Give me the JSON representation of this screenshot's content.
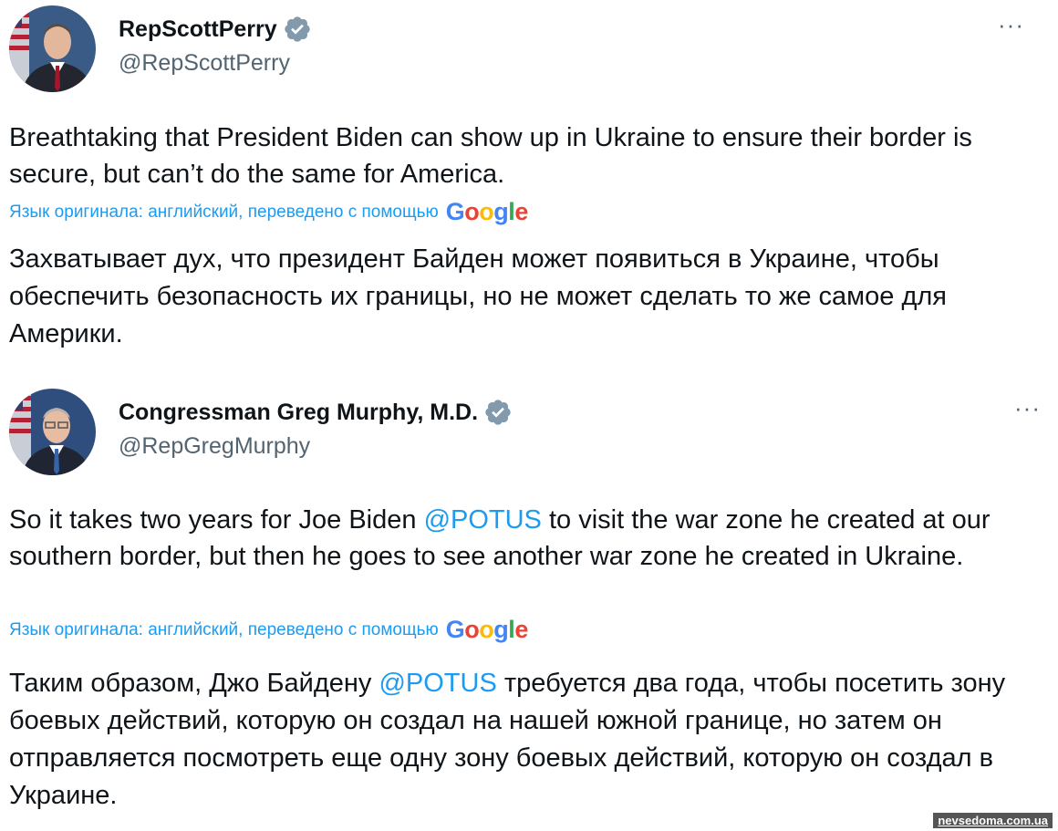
{
  "tweets": [
    {
      "display_name": "RepScottPerry",
      "handle": "@RepScottPerry",
      "more_label": "···",
      "text_en": "Breathtaking that President Biden can show up in Ukraine to ensure their border is secure, but can’t do the same for America.",
      "translation_note": "Язык оригинала: английский, переведено с помощью",
      "translation_provider": "Google",
      "text_ru": "Захватывает дух, что президент Байден может появиться в Украине, чтобы обеспечить безопасность их границы, но не может сделать то же самое для Америки."
    },
    {
      "display_name": "Congressman Greg Murphy, M.D.",
      "handle": "@RepGregMurphy",
      "more_label": "···",
      "text_en_before": "So it takes two years for Joe Biden ",
      "text_en_mention": "@POTUS",
      "text_en_after": " to visit the war zone he created at our southern border, but then he goes to see another war zone he created in Ukraine.",
      "translation_note": "Язык оригинала: английский, переведено с помощью",
      "translation_provider": "Google",
      "text_ru_before": "Таким образом, Джо Байдену ",
      "text_ru_mention": "@POTUS",
      "text_ru_after": " требуется два года, чтобы посетить зону боевых действий, которую он создал на нашей южной границе, но затем он отправляется посмотреть еще одну зону боевых действий, которую он создал в Украине."
    }
  ],
  "watermark": "nevsedoma.com.ua",
  "colors": {
    "link": "#1d9bf0",
    "secondary_text": "#536471",
    "verified_badge": "#829aab"
  },
  "icons": {
    "verified": "verified-badge-icon",
    "more": "more-options-icon"
  }
}
